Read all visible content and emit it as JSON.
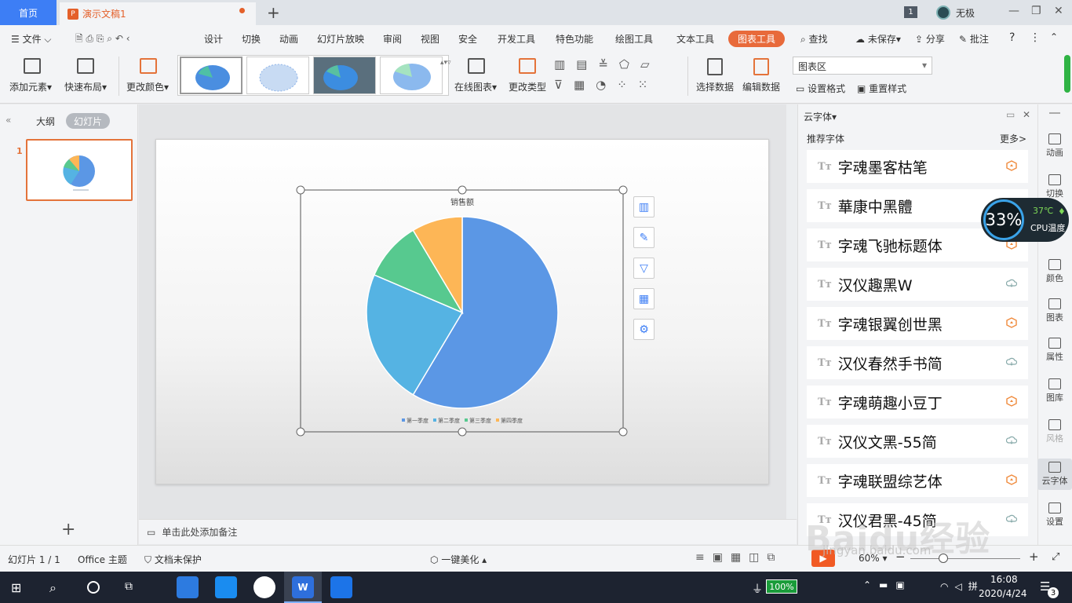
{
  "titlebar": {
    "home_tab": "首页",
    "doc_tab": "演示文稿1",
    "badge": "1",
    "user": "无极"
  },
  "menu": {
    "file": "文件",
    "items": [
      "设计",
      "切换",
      "动画",
      "幻灯片放映",
      "审阅",
      "视图",
      "安全",
      "开发工具",
      "特色功能",
      "绘图工具",
      "文本工具"
    ],
    "chart_tools": "图表工具",
    "search": "查找",
    "unsaved": "未保存",
    "share": "分享",
    "comment": "批注"
  },
  "ribbon": {
    "add_element": "添加元素",
    "quick_layout": "快速布局",
    "change_color": "更改颜色",
    "online_chart": "在线图表",
    "change_type": "更改类型",
    "select_data": "选择数据",
    "edit_data": "编辑数据",
    "chart_area": "图表区",
    "set_format": "设置格式",
    "reset_style": "重置样式"
  },
  "leftpanel": {
    "outline": "大纲",
    "slides": "幻灯片",
    "slide_number": "1"
  },
  "slide": {
    "chart_title": "销售额"
  },
  "chart_data": {
    "type": "pie",
    "title": "销售额",
    "categories": [
      "第一季度",
      "第二季度",
      "第三季度",
      "第四季度"
    ],
    "values": [
      8.2,
      3.2,
      1.4,
      1.2
    ],
    "colors": [
      "#5b97e5",
      "#55b3e3",
      "#57c98f",
      "#fdb656"
    ],
    "legend": "bottom"
  },
  "notes": {
    "placeholder": "单击此处添加备注"
  },
  "rightpanel": {
    "title": "云字体",
    "recommended": "推荐字体",
    "more": "更多>",
    "fonts": [
      {
        "name": "字魂墨客枯笔",
        "status": "vip"
      },
      {
        "name": "華康中黑體",
        "status": "cloud"
      },
      {
        "name": "字魂飞驰标题体",
        "status": "vip"
      },
      {
        "name": "汉仪趣黑W",
        "status": "cloud"
      },
      {
        "name": "字魂银翼创世黑",
        "status": "vip"
      },
      {
        "name": "汉仪春然手书简",
        "status": "cloud"
      },
      {
        "name": "字魂萌趣小豆丁",
        "status": "vip"
      },
      {
        "name": "汉仪文黑-55简",
        "status": "cloud"
      },
      {
        "name": "字魂联盟综艺体",
        "status": "vip"
      },
      {
        "name": "汉仪君黑-45简",
        "status": "cloud"
      }
    ]
  },
  "iconbar": [
    "动画",
    "切换",
    "颜色",
    "图表",
    "属性",
    "图库",
    "风格",
    "云字体",
    "设置"
  ],
  "cpu": {
    "percent": "33%",
    "temp": "37℃",
    "label": "CPU温度"
  },
  "status": {
    "slide_pos": "幻灯片 1 / 1",
    "theme": "Office 主题",
    "protect": "文档未保护",
    "beautify": "一键美化",
    "zoom": "60%"
  },
  "taskbar": {
    "battery": "100%",
    "time": "16:08",
    "date": "2020/4/24",
    "notif": "3"
  },
  "watermark": {
    "brand": "Baidu经验",
    "url": "jingyan.baidu.com"
  }
}
